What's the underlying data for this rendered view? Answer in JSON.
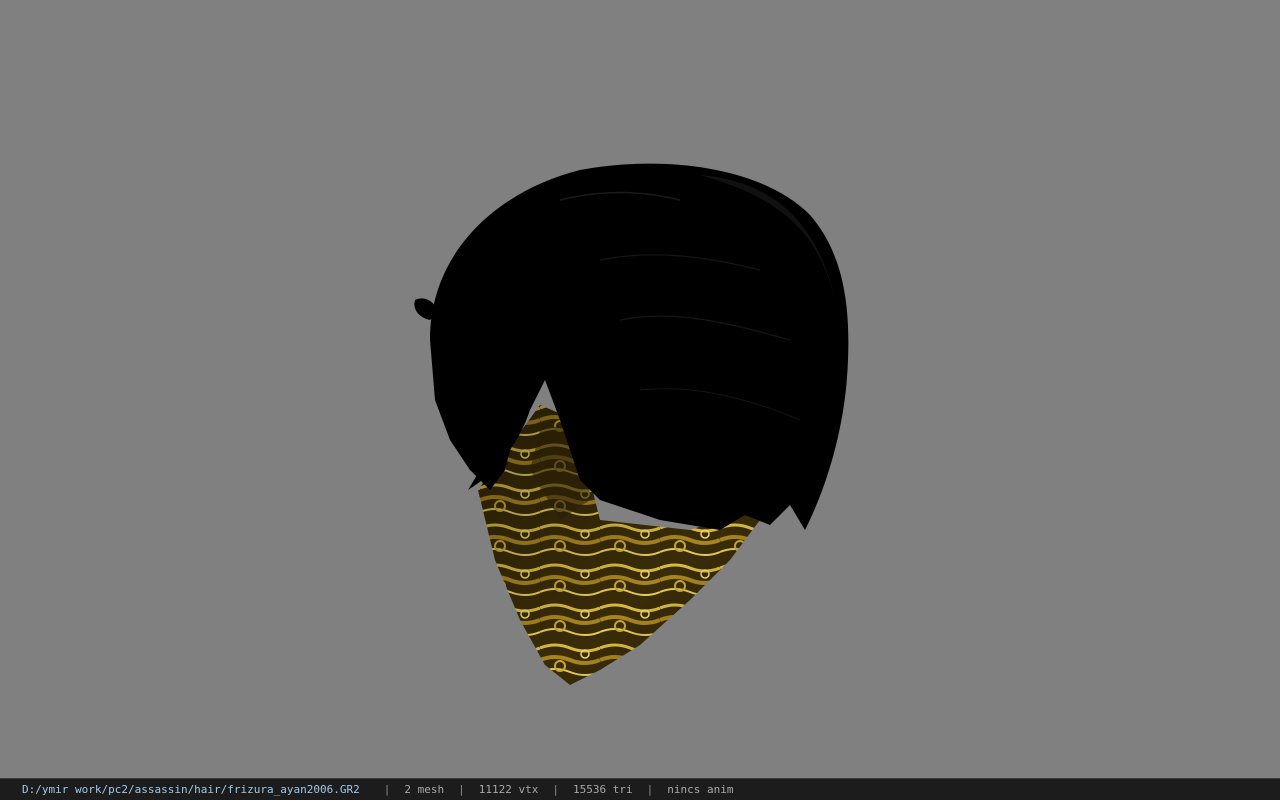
{
  "status": {
    "file_path": "D:/ymir work/pc2/assassin/hair/frizura_ayan2006.GR2",
    "separator": "|",
    "mesh_count": "2 mesh",
    "vertex_count": "11122 vtx",
    "triangle_count": "15536 tri",
    "anim_status": "nincs anim"
  },
  "colors": {
    "background": "#808080",
    "status_bar": "#1c1c1c",
    "path_text": "#9fc8e8",
    "status_text": "#a8a8a8",
    "hair": "#000000",
    "mask_gold": "#b8962a"
  }
}
